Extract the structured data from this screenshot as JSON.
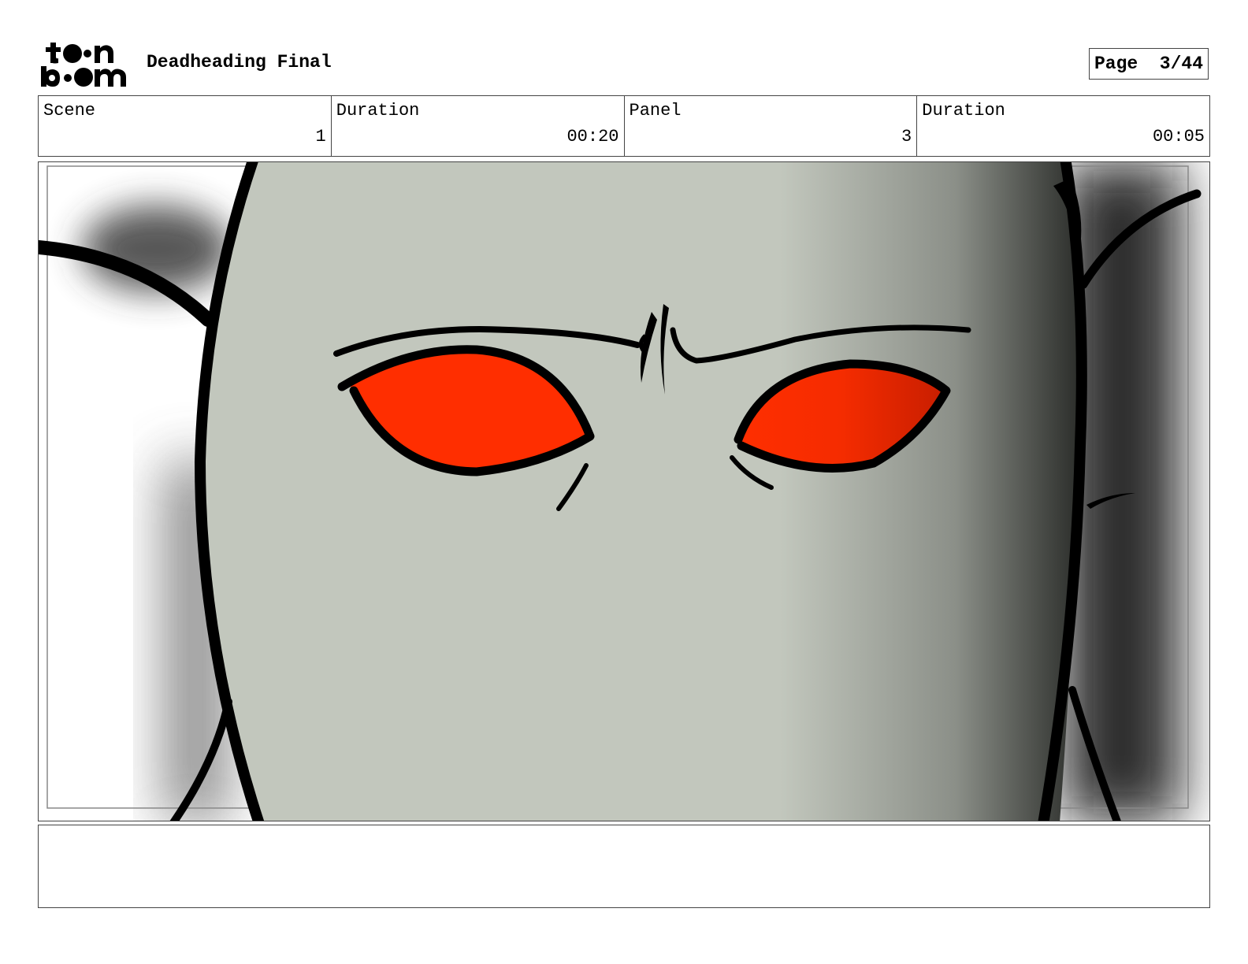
{
  "header": {
    "logo": {
      "text": "toonboom",
      "icon": "toon-boom-logo"
    },
    "project_title": "Deadheading Final",
    "page_label": "Page",
    "page_value": "3/44"
  },
  "info": {
    "scene_label": "Scene",
    "scene_value": "1",
    "scene_duration_label": "Duration",
    "scene_duration_value": "00:20",
    "panel_label": "Panel",
    "panel_value": "3",
    "panel_duration_label": "Duration",
    "panel_duration_value": "00:05"
  },
  "panel_image": {
    "subject": "grey-creature-face-with-red-eyes",
    "colors": {
      "skin": "#c2c7bd",
      "eye": "#ff2e00",
      "outline": "#000000"
    }
  },
  "caption": {
    "text": ""
  }
}
